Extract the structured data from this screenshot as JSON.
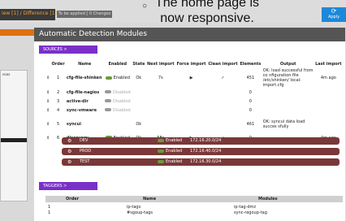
{
  "topbar": {
    "review_text": "iew [1] / Difference [1]",
    "applied_text": "To be applied [ 0 Changes ]",
    "apply_label": "Apply"
  },
  "overlay": {
    "bullet": "○",
    "line1": "The home page is",
    "line2": "now responsive."
  },
  "leftpanel": {
    "label": "nces"
  },
  "page": {
    "title": "Automatic Detection Modules"
  },
  "sources": {
    "pill": "SOURCES >",
    "columns": [
      "Order",
      "Name",
      "Enabled",
      "State",
      "Next import",
      "Force import",
      "Clean import",
      "Elements",
      "Output",
      "Last import"
    ],
    "rows": [
      {
        "order": "1",
        "name": "cfg-file-shinken",
        "enabled": "Enabled",
        "state": "Ok",
        "next": "7s",
        "force": "▶",
        "clean": "✓",
        "elements": "451",
        "output": "OK: load successful from co nfiguration file /etc/shinken/ local-import.cfg",
        "last": "4m ago",
        "on": true
      },
      {
        "order": "2",
        "name": "cfg-file-nagios",
        "enabled": "Disabled",
        "state": "",
        "next": "",
        "force": "",
        "clean": "",
        "elements": "0",
        "output": "",
        "last": "",
        "on": false
      },
      {
        "order": "3",
        "name": "active-dir",
        "enabled": "Disabled",
        "state": "",
        "next": "",
        "force": "",
        "clean": "",
        "elements": "0",
        "output": "",
        "last": "",
        "on": false
      },
      {
        "order": "4",
        "name": "sync-vmware",
        "enabled": "Disabled",
        "state": "",
        "next": "",
        "force": "",
        "clean": "",
        "elements": "0",
        "output": "",
        "last": "",
        "on": false
      },
      {
        "order": "5",
        "name": "syncui",
        "enabled": "",
        "state": "Ok",
        "next": "",
        "force": "",
        "clean": "",
        "elements": "461",
        "output": "OK: syncui data load succes sfully",
        "last": "",
        "on": null
      },
      {
        "order": "6",
        "name": "discovery",
        "enabled": "Enabled",
        "state": "Ok",
        "next": "58s",
        "force": "▶",
        "clean": "✓",
        "elements": "0",
        "output": "",
        "last": "4m ago",
        "on": true
      }
    ],
    "discovery_children": [
      {
        "name": "DEV",
        "status": "Enabled",
        "ip": "172.16.20.0/24"
      },
      {
        "name": "PROD",
        "status": "Enabled",
        "ip": "172.16.40.0/24"
      },
      {
        "name": "TEST",
        "status": "Enabled",
        "ip": "172.16.30.0/24"
      }
    ]
  },
  "taggers": {
    "pill": "TAGGERS >",
    "columns": [
      "Order",
      "Name",
      "Modules"
    ],
    "rows": [
      {
        "order": "1",
        "name": "ip-tags",
        "modules": "ip-tag-dmz"
      },
      {
        "order": "1",
        "name": "#sgoup-tags",
        "modules": "sync-regoup-tag"
      }
    ]
  },
  "icons": {
    "gear": "gear-icon",
    "play": "play-icon",
    "check": "check-icon",
    "updown": "updown-icon"
  }
}
